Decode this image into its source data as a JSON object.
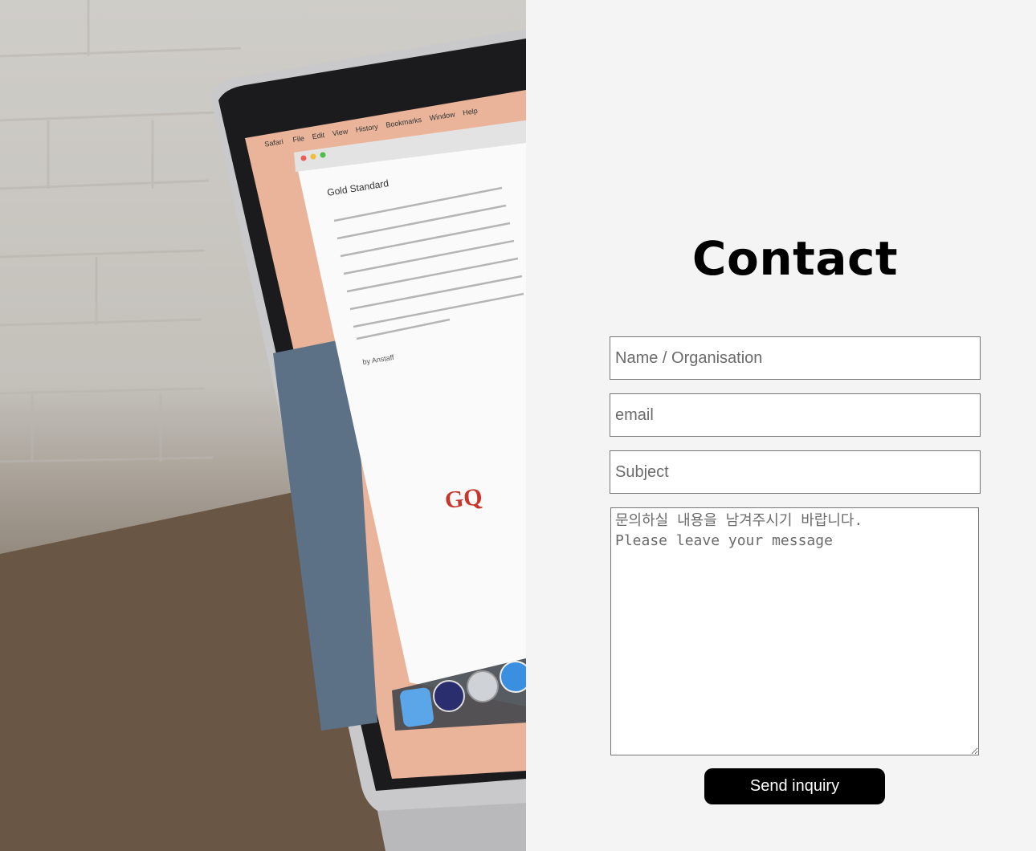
{
  "contact": {
    "title": "Contact",
    "fields": {
      "name_placeholder": "Name / Organisation",
      "email_placeholder": "email",
      "subject_placeholder": "Subject",
      "message_placeholder": "문의하실 내용을 남겨주시기 바랍니다.\nPlease leave your message"
    },
    "submit_label": "Send inquiry"
  },
  "photo": {
    "menu_items": [
      "Safari",
      "File",
      "Edit",
      "View",
      "History",
      "Bookmarks",
      "Window",
      "Help"
    ],
    "article_title": "Gold Standard",
    "byline": "by Anstaff",
    "logo_text": "GQ"
  },
  "colors": {
    "page_background": "#f4f4f4",
    "button_background": "#000000",
    "button_text": "#ffffff",
    "field_border": "#767676"
  }
}
